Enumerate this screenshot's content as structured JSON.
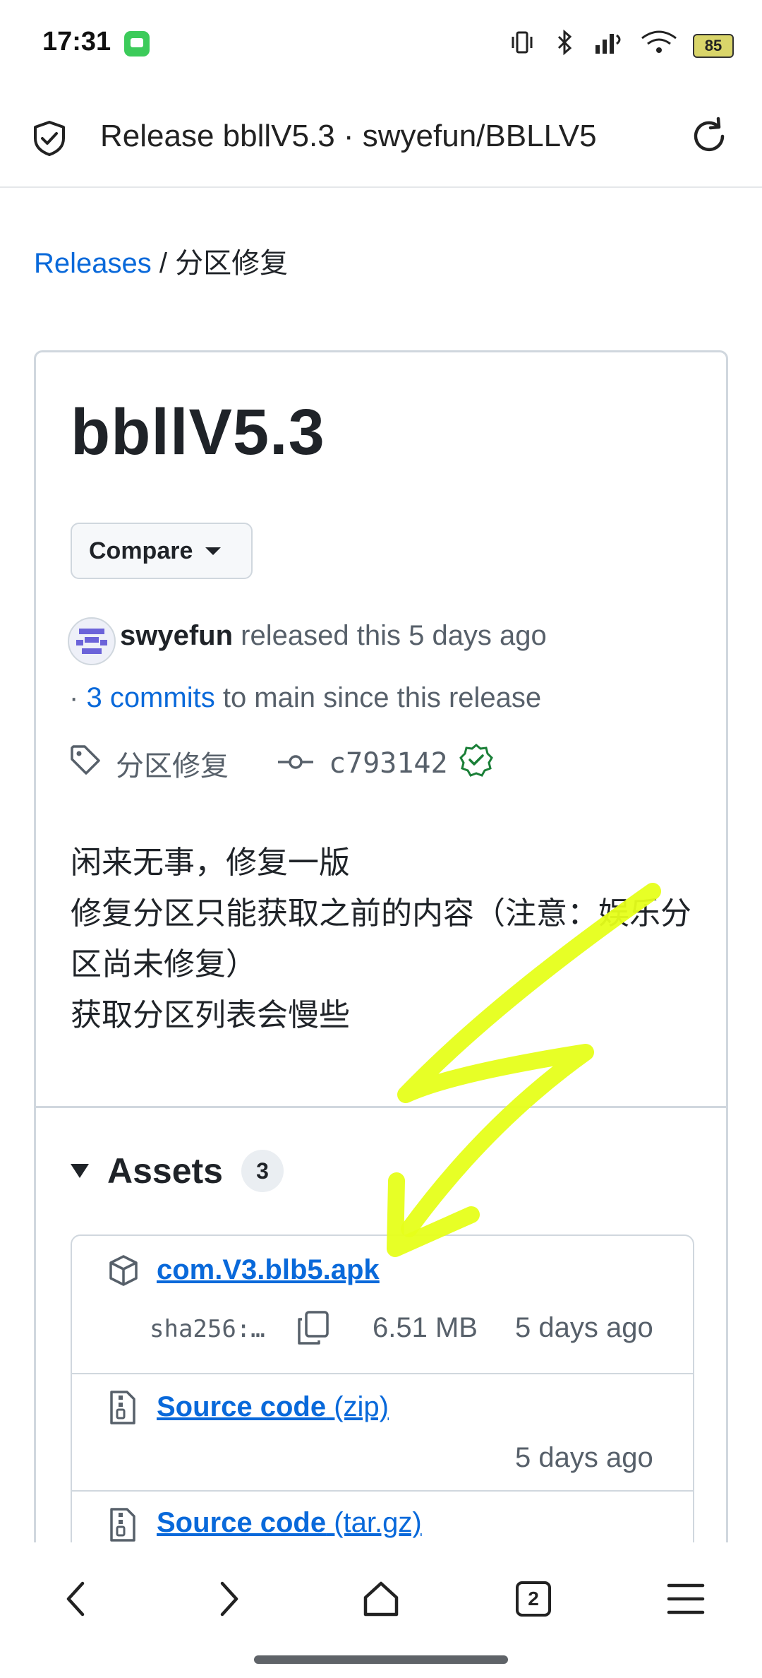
{
  "status_bar": {
    "time": "17:31",
    "battery": "85",
    "icons": [
      "app-notification-icon",
      "vibrate-icon",
      "bluetooth-icon",
      "signal-icon",
      "wifi-icon",
      "battery-icon"
    ]
  },
  "browser": {
    "page_title": "Release bbllV5.3 · swyefun/BBLLV5",
    "security_icon": "shield-check-icon",
    "reload_icon": "reload-icon"
  },
  "breadcrumb": {
    "root": "Releases",
    "separator": "/",
    "current": "分区修复"
  },
  "release": {
    "title": "bbllV5.3",
    "compare_label": "Compare",
    "author": "swyefun",
    "released_text": "released this 5 days ago",
    "commits_prefix": "·",
    "commits_link": "3 commits",
    "commits_suffix": "to main since this release",
    "tag": "分区修复",
    "commit_hash": "c793142",
    "body_lines": [
      "闲来无事，修复一版",
      "修复分区只能获取之前的内容（注意：娱乐分区尚未修复）",
      "获取分区列表会慢些"
    ]
  },
  "assets": {
    "title": "Assets",
    "count": "3",
    "items": [
      {
        "name": "com.V3.blb5.apk",
        "sha": "sha256:…",
        "size": "6.51 MB",
        "date": "5 days ago"
      },
      {
        "name": "Source code",
        "suffix": "(zip)",
        "date": "5 days ago"
      },
      {
        "name": "Source code",
        "suffix": "(tar.gz)"
      }
    ]
  },
  "bottom_nav": {
    "tab_count": "2",
    "items": [
      "back-icon",
      "forward-icon",
      "home-icon",
      "tabs-icon",
      "menu-icon"
    ]
  },
  "colors": {
    "link": "#0969da",
    "text": "#1f2328",
    "muted": "#57606a",
    "border": "#d0d7de",
    "verified": "#1a7f37",
    "annotation_arrow": "#e6ff1a"
  }
}
